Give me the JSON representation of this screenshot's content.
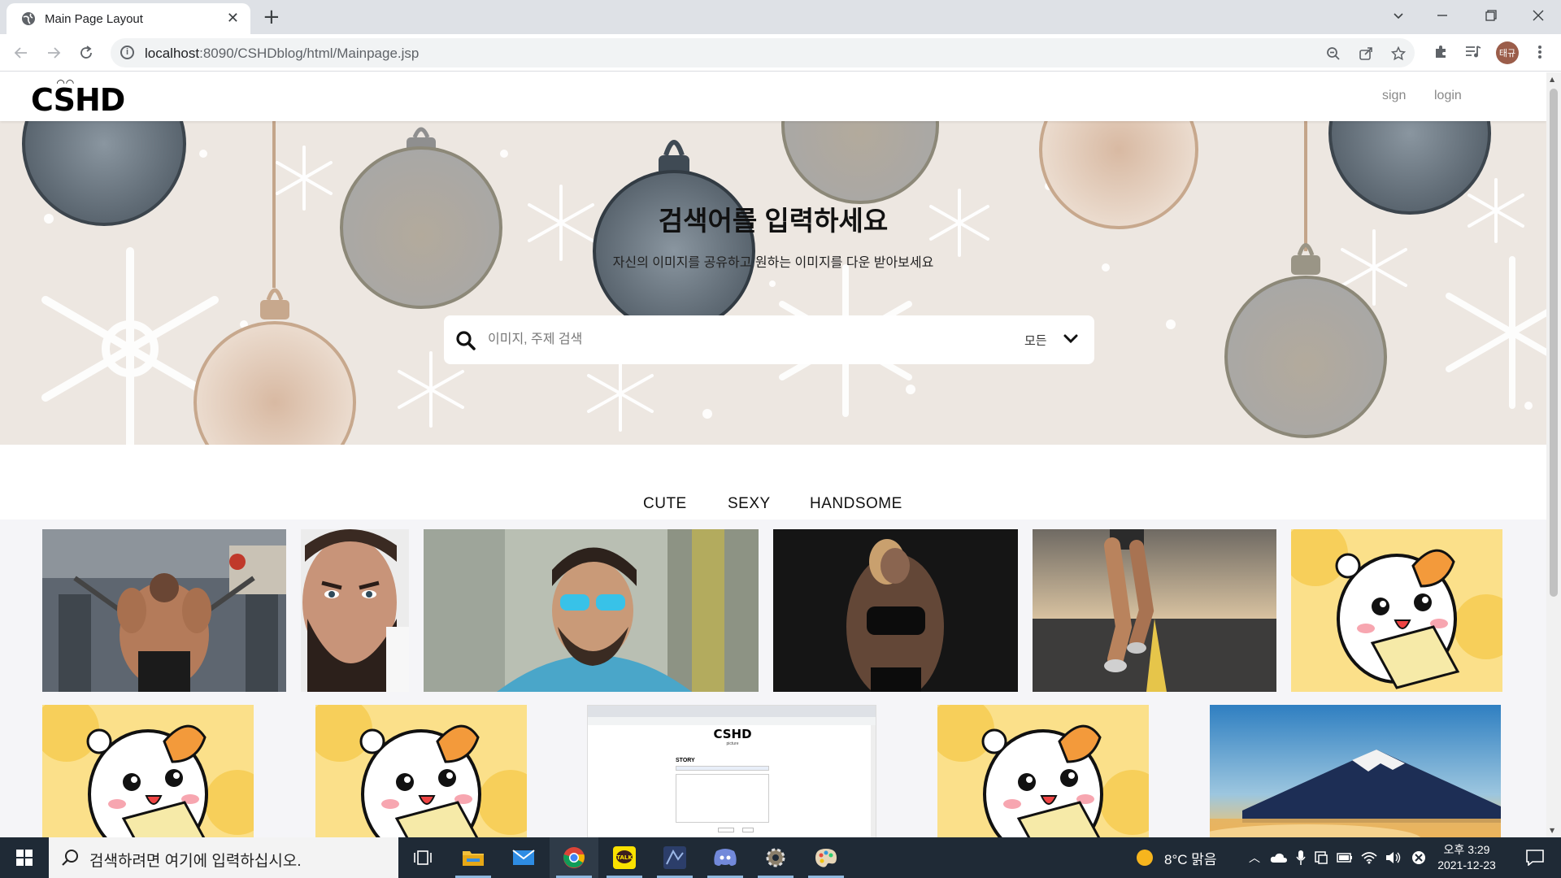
{
  "browser": {
    "tab_title": "Main Page Layout",
    "url_host": "localhost",
    "url_rest": ":8090/CSHDblog/html/Mainpage.jsp",
    "profile_initials": "태규"
  },
  "site": {
    "logo": "CSHD",
    "nav": {
      "sign": "sign",
      "login": "login"
    }
  },
  "hero": {
    "title": "검색어를 입력하세요",
    "subtitle": "자신의 이미지를 공유하고 원하는 이미지를 다운 받아보세요",
    "search_placeholder": "이미지, 주제 검색",
    "search_scope": "모든"
  },
  "categories": [
    "CUTE",
    "SEXY",
    "HANDSOME"
  ],
  "gallery": {
    "row1": [
      "gym-back-photo",
      "bearded-man-photo",
      "sunglasses-man-photo",
      "fitness-woman-photo",
      "runner-legs-photo",
      "hamster-cartoon"
    ],
    "row2": [
      "hamster-cartoon",
      "hamster-cartoon",
      "blog-screenshot",
      "hamster-cartoon",
      "mount-fuji-photo"
    ],
    "screenshot_logo": "CSHD",
    "screenshot_caption": "picture",
    "screenshot_label": "STORY"
  },
  "taskbar": {
    "search_placeholder": "검색하려면 여기에 입력하십시오.",
    "weather": "8°C 맑음",
    "time": "오후 3:29",
    "date": "2021-12-23"
  },
  "colors": {
    "hero_bg": "#ede7e1",
    "taskbar_bg": "#1f2a36",
    "hamster_bg": "#fbe08a"
  }
}
